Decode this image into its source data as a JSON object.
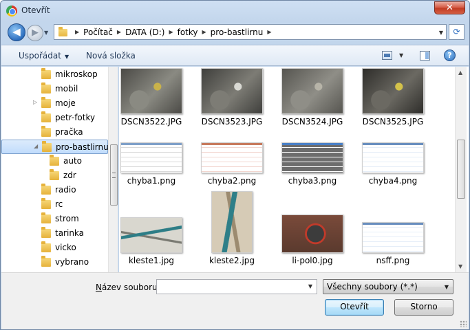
{
  "window": {
    "title": "Otevřít",
    "close_label": "✕"
  },
  "address": {
    "crumbs": [
      "Počítač",
      "DATA (D:)",
      "fotky",
      "pro-bastlirnu"
    ]
  },
  "toolbar": {
    "organize": "Uspořádat",
    "new_folder": "Nová složka",
    "help": "?"
  },
  "nav_tree": [
    {
      "label": "mikroskop",
      "indent": 0,
      "expander": ""
    },
    {
      "label": "mobil",
      "indent": 0,
      "expander": ""
    },
    {
      "label": "moje",
      "indent": 0,
      "expander": "▷"
    },
    {
      "label": "petr-fotky",
      "indent": 0,
      "expander": ""
    },
    {
      "label": "pračka",
      "indent": 0,
      "expander": ""
    },
    {
      "label": "pro-bastlirnu",
      "indent": 0,
      "expander": "◢",
      "selected": true
    },
    {
      "label": "auto",
      "indent": 1,
      "expander": ""
    },
    {
      "label": "zdr",
      "indent": 1,
      "expander": ""
    },
    {
      "label": "radio",
      "indent": 0,
      "expander": ""
    },
    {
      "label": "rc",
      "indent": 0,
      "expander": ""
    },
    {
      "label": "strom",
      "indent": 0,
      "expander": ""
    },
    {
      "label": "tarinka",
      "indent": 0,
      "expander": ""
    },
    {
      "label": "vicko",
      "indent": 0,
      "expander": ""
    },
    {
      "label": "vybrano",
      "indent": 0,
      "expander": ""
    }
  ],
  "files": [
    {
      "name": "DSCN3522.JPG",
      "kind": "photo-dark",
      "colors": [
        "#4b4a46",
        "#8a8a82",
        "#c9b24a"
      ]
    },
    {
      "name": "DSCN3523.JPG",
      "kind": "photo-dark",
      "colors": [
        "#3f3f3c",
        "#7d7c75",
        "#d9d9d3"
      ]
    },
    {
      "name": "DSCN3524.JPG",
      "kind": "photo-dark",
      "colors": [
        "#565550",
        "#8f8e87",
        "#b7b4a8"
      ]
    },
    {
      "name": "DSCN3525.JPG",
      "kind": "photo-dark",
      "colors": [
        "#2e2d2a",
        "#6b6962",
        "#d4c24a"
      ]
    },
    {
      "name": "chyba1.png",
      "kind": "screenshot",
      "colors": [
        "#ffffff",
        "#d9d9d9",
        "#7fa0c8"
      ]
    },
    {
      "name": "chyba2.png",
      "kind": "screenshot",
      "colors": [
        "#ffffff",
        "#f2d6cf",
        "#c77b5e"
      ]
    },
    {
      "name": "chyba3.png",
      "kind": "screenshot",
      "colors": [
        "#6d6d6d",
        "#ffffff",
        "#4a80c7"
      ]
    },
    {
      "name": "chyba4.png",
      "kind": "screenshot",
      "colors": [
        "#ffffff",
        "#e6eef8",
        "#6a8fbf"
      ]
    },
    {
      "name": "kleste1.jpg",
      "kind": "photo-pliers",
      "colors": [
        "#d9d7cf",
        "#2d7d86",
        "#7a7a72"
      ]
    },
    {
      "name": "kleste2.jpg",
      "kind": "photo-pliers-tall",
      "colors": [
        "#d6cbb6",
        "#2f7f88",
        "#9c8b70"
      ]
    },
    {
      "name": "li-pol0.jpg",
      "kind": "photo-motor",
      "colors": [
        "#7a4a3a",
        "#3c3c3c",
        "#c23a2a"
      ]
    },
    {
      "name": "nsff.png",
      "kind": "screenshot",
      "colors": [
        "#ffffff",
        "#e6eef8",
        "#6a8fbf"
      ]
    }
  ],
  "bottom": {
    "filename_label_underlined": "N",
    "filename_label_rest": "ázev souboru:",
    "filename_value": "",
    "filetype_value": "Všechny soubory (*.*)",
    "open_button": "Otevřít",
    "cancel_button": "Storno"
  }
}
